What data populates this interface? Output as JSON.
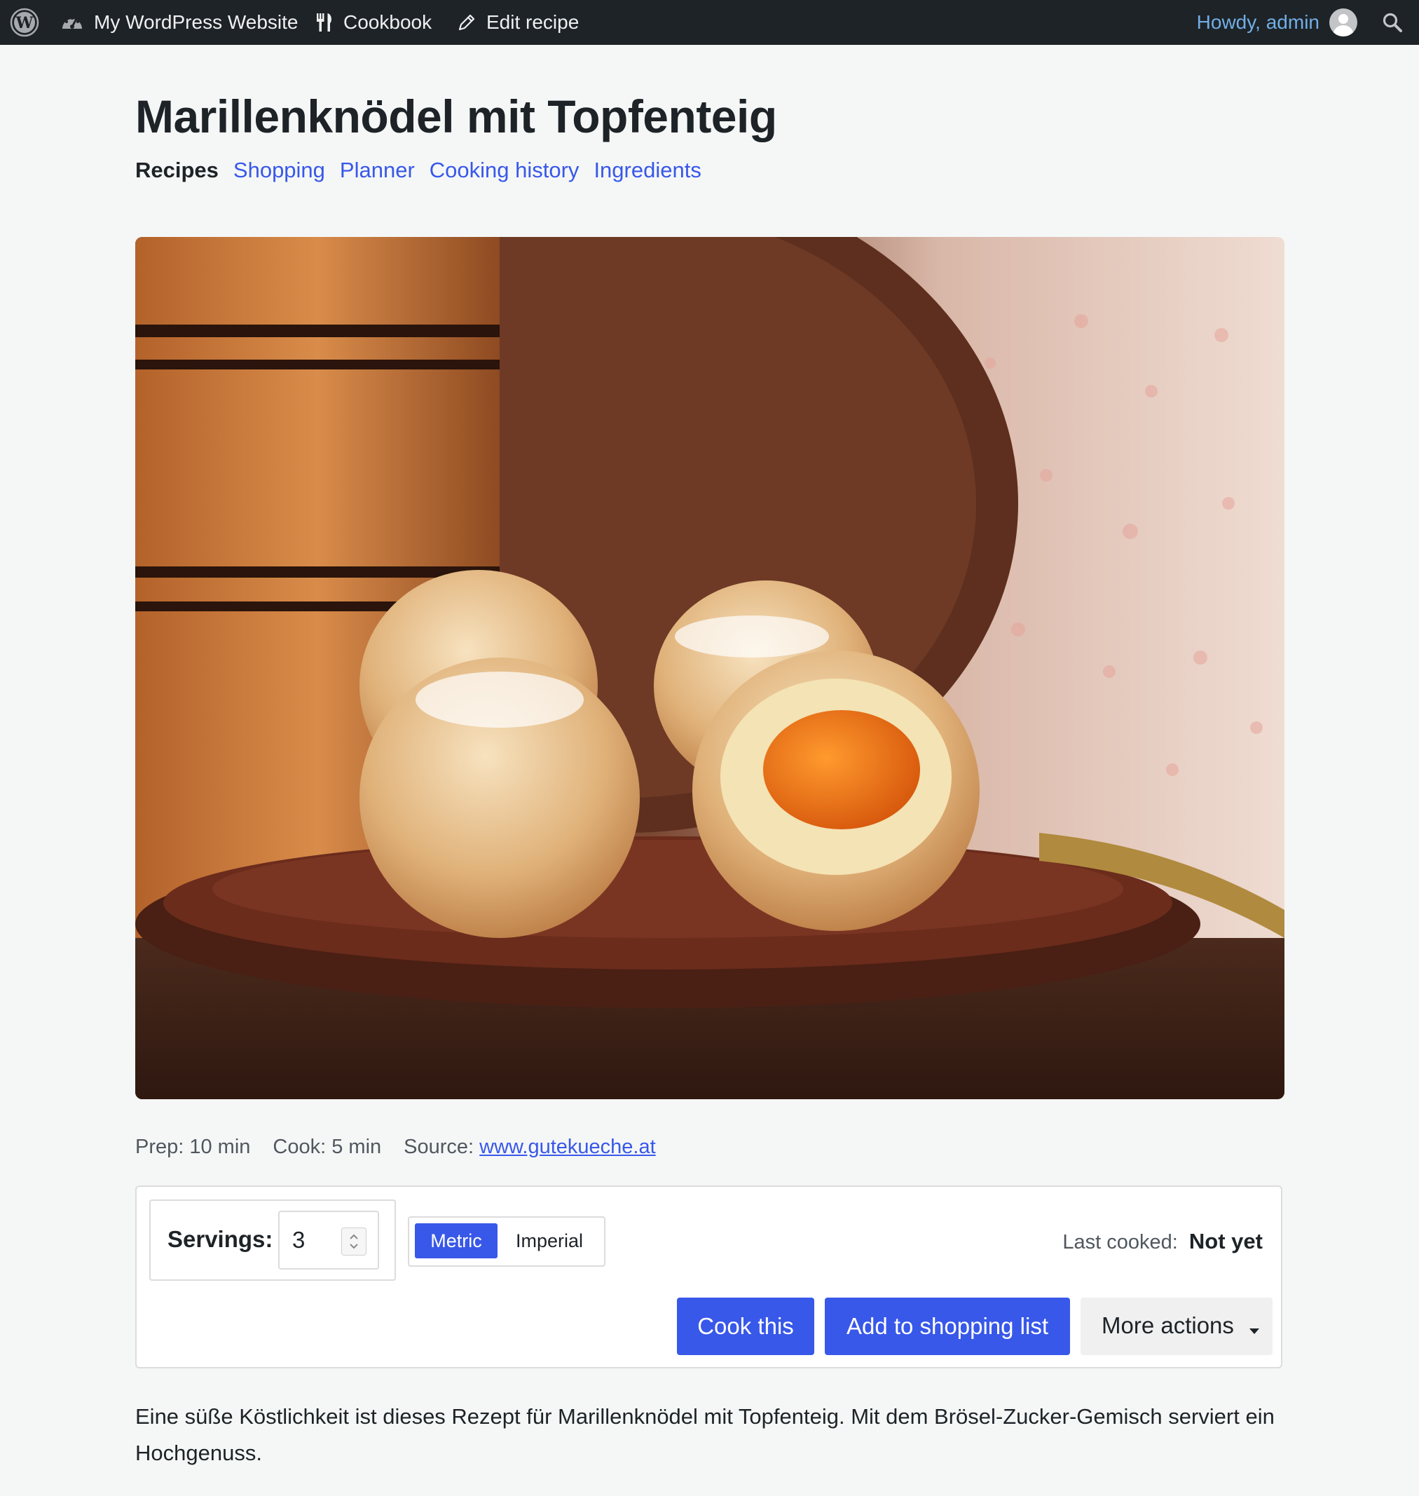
{
  "adminbar": {
    "wp_logo_icon": "wordpress-logo-icon",
    "site_name": "My WordPress Website",
    "site_icon": "dashboard-icon",
    "cookbook_label": "Cookbook",
    "cookbook_icon": "fork-knife-icon",
    "edit_label": "Edit recipe",
    "edit_icon": "pencil-icon",
    "howdy": "Howdy, admin",
    "search_icon": "search-icon"
  },
  "recipe": {
    "title": "Marillenknödel mit Topfenteig",
    "tabs": [
      {
        "label": "Recipes",
        "active": true
      },
      {
        "label": "Shopping",
        "active": false
      },
      {
        "label": "Planner",
        "active": false
      },
      {
        "label": "Cooking history",
        "active": false
      },
      {
        "label": "Ingredients",
        "active": false
      }
    ],
    "prep": "Prep: 10 min",
    "cook": "Cook: 5 min",
    "source_label": "Source:",
    "source_link": "www.gutekueche.at",
    "servings_label": "Servings:",
    "servings_value": "3",
    "units": {
      "metric": "Metric",
      "imperial": "Imperial",
      "selected": "Metric"
    },
    "last_cooked_label": "Last cooked:",
    "last_cooked_value": "Not yet",
    "actions": {
      "cook": "Cook this",
      "shopping": "Add to shopping list",
      "more": "More actions"
    },
    "description": "Eine süße Köstlichkeit ist dieses Rezept für Marillenknödel mit Topfenteig. Mit dem Brösel-Zucker-Gemisch serviert ein Hochgenuss."
  },
  "colors": {
    "adminbar_bg": "#1d2327",
    "accent": "#3858e9",
    "howdy": "#72aee6",
    "page_bg": "#f5f7f7"
  }
}
